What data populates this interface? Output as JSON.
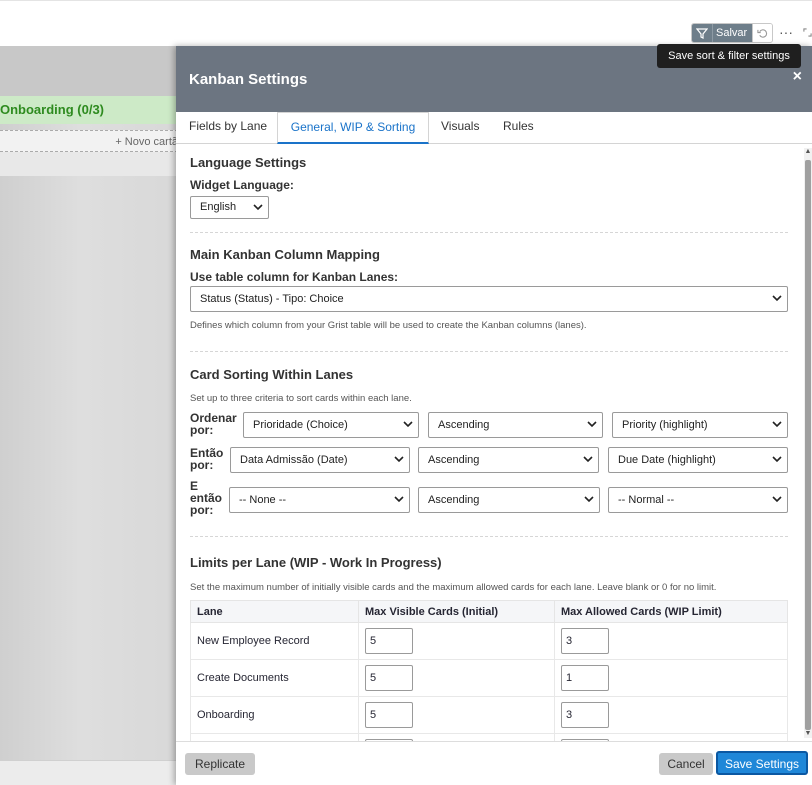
{
  "toolbar": {
    "save_label": "Salvar",
    "more_label": "···",
    "tooltip": "Save sort & filter settings"
  },
  "background": {
    "lane_title": "Onboarding (0/3)",
    "new_card": "+ Novo cartã"
  },
  "modal": {
    "title": "Kanban Settings",
    "close_label": "×",
    "tabs": [
      {
        "label": "Fields by Lane"
      },
      {
        "label": "General, WIP & Sorting"
      },
      {
        "label": "Visuals"
      },
      {
        "label": "Rules"
      }
    ],
    "language": {
      "section_title": "Language Settings",
      "widget_language_label": "Widget Language:",
      "widget_language_value": "English"
    },
    "mapping": {
      "section_title": "Main Kanban Column Mapping",
      "label": "Use table column for Kanban Lanes:",
      "value": "Status (Status) - Tipo: Choice",
      "help": "Defines which column from your Grist table will be used to create the Kanban columns (lanes)."
    },
    "sorting": {
      "section_title": "Card Sorting Within Lanes",
      "help": "Set up to three criteria to sort cards within each lane.",
      "rows": [
        {
          "label_line1": "Ordenar",
          "label_line2": "por:",
          "label_line3": "",
          "field": "Prioridade (Choice)",
          "direction": "Ascending",
          "highlight": "Priority (highlight)"
        },
        {
          "label_line1": "Então",
          "label_line2": "por:",
          "label_line3": "",
          "field": "Data Admissão (Date)",
          "direction": "Ascending",
          "highlight": "Due Date (highlight)"
        },
        {
          "label_line1": "E",
          "label_line2": "então",
          "label_line3": "por:",
          "field": "-- None --",
          "direction": "Ascending",
          "highlight": "-- Normal --"
        }
      ]
    },
    "wip": {
      "section_title": "Limits per Lane (WIP - Work In Progress)",
      "help": "Set the maximum number of initially visible cards and the maximum allowed cards for each lane. Leave blank or 0 for no limit.",
      "headers": [
        "Lane",
        "Max Visible Cards (Initial)",
        "Max Allowed Cards (WIP Limit)"
      ],
      "rows": [
        {
          "lane": "New Employee Record",
          "visible": "5",
          "allowed": "3"
        },
        {
          "lane": "Create Documents",
          "visible": "5",
          "allowed": "1"
        },
        {
          "lane": "Onboarding",
          "visible": "5",
          "allowed": "3"
        }
      ]
    },
    "footer": {
      "replicate": "Replicate",
      "cancel": "Cancel",
      "save": "Save Settings"
    }
  }
}
